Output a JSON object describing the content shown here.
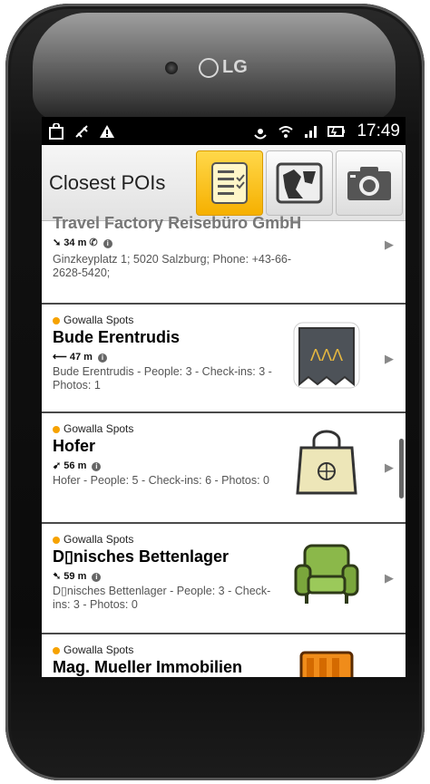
{
  "device": {
    "brand": "LG"
  },
  "status_bar": {
    "icons": [
      "shopping-bag-icon",
      "cpu-icon",
      "warning-icon",
      "gps-icon",
      "wifi-icon",
      "signal-icon",
      "battery-icon"
    ],
    "time": "17:49"
  },
  "action_bar": {
    "title": "Closest POIs",
    "buttons": [
      {
        "name": "list-view",
        "active": true
      },
      {
        "name": "map-view",
        "active": false
      },
      {
        "name": "camera-view",
        "active": false
      }
    ]
  },
  "items": [
    {
      "source": "",
      "name": "Travel Factory Reisebüro GmbH",
      "distance": "34 m",
      "description": "Ginzkeyplatz 1; 5020 Salzburg; Phone: +43-66-2628-5420;"
    },
    {
      "source": "Gowalla Spots",
      "name": "Bude Erentrudis",
      "distance": "47 m",
      "description": "Bude Erentrudis - People: 3 - Check-ins: 3 - Photos: 1",
      "thumb_icon": "flag-banner-icon"
    },
    {
      "source": "Gowalla Spots",
      "name": "Hofer",
      "distance": "56 m",
      "description": "Hofer - People: 5 - Check-ins: 6 - Photos: 0",
      "thumb_icon": "shopping-bag-icon"
    },
    {
      "source": "Gowalla Spots",
      "name": "D▯nisches Bettenlager",
      "distance": "59 m",
      "description": "D▯nisches Bettenlager - People: 3 - Check-ins: 3 - Photos: 0",
      "thumb_icon": "armchair-icon"
    },
    {
      "source": "Gowalla Spots",
      "name": "Mag. Mueller Immobilien",
      "distance": "",
      "description": "",
      "thumb_icon": "building-icon"
    }
  ]
}
